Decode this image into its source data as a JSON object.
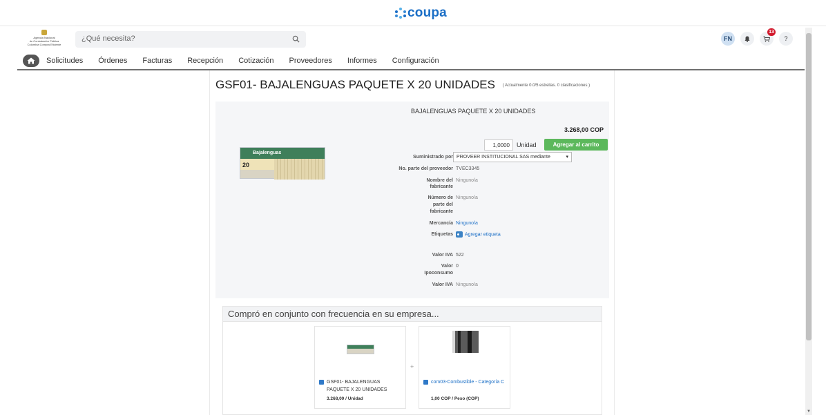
{
  "brand": {
    "name": "coupa"
  },
  "org_logo": {
    "line1": "Agencia Nacional",
    "line2": "de Contratación Pública",
    "line3": "Colombia Compra Eficiente"
  },
  "header": {
    "search_placeholder": "¿Qué necesita?",
    "user_initials": "FN",
    "cart_count": "13",
    "help_label": "?"
  },
  "nav": {
    "items": [
      "Solicitudes",
      "Órdenes",
      "Facturas",
      "Recepción",
      "Cotización",
      "Proveedores",
      "Informes",
      "Configuración"
    ]
  },
  "product": {
    "title": "GSF01- BAJALENGUAS PAQUETE X 20 UNIDADES",
    "rating_text": "( Actualmente 0.0/5 estrellas. 0 clasificaciones )",
    "subtitle": "BAJALENGUAS PAQUETE X 20 UNIDADES",
    "price": "3.268,00 COP",
    "quantity": "1,0000",
    "unit": "Unidad",
    "add_to_cart_label": "Agregar al carrito",
    "image_label": "Bajalenguas",
    "image_count": "20",
    "fields": {
      "supplied_by_label": "Suministrado por",
      "supplied_by_value": "PROVEER INSTITUCIONAL SAS mediante",
      "supplier_part_label": "No. parte del proveedor",
      "supplier_part_value": "TVEC3345",
      "manufacturer_name_label_1": "Nombre del",
      "manufacturer_name_label_2": "fabricante",
      "manufacturer_name_value": "Ninguno/a",
      "manufacturer_part_label_1": "Número de",
      "manufacturer_part_label_2": "parte del",
      "manufacturer_part_label_3": "fabricante",
      "manufacturer_part_value": "Ninguno/a",
      "commodity_label": "Mercancía",
      "commodity_value": "Ninguno/a",
      "tags_label": "Etiquetas",
      "tags_value": "Agregar etiqueta",
      "iva_label": "Valor IVA",
      "iva_value": "522",
      "ipoconsumo_label_1": "Valor",
      "ipoconsumo_label_2": "Ipoconsumo",
      "ipoconsumo_value": "0",
      "iva2_label": "Valor IVA",
      "iva2_value": "Ninguno/a"
    }
  },
  "frequently_bought": {
    "heading": "Compró en conjunto con frecuencia en su empresa...",
    "plus": "+",
    "items": [
      {
        "name": "GSF01- BAJALENGUAS PAQUETE X 20 UNIDADES",
        "price": "3.268,00 / Unidad"
      },
      {
        "name": "com03-Combustible - Categoría C",
        "price": "1,00 COP / Peso (COP)"
      }
    ]
  }
}
